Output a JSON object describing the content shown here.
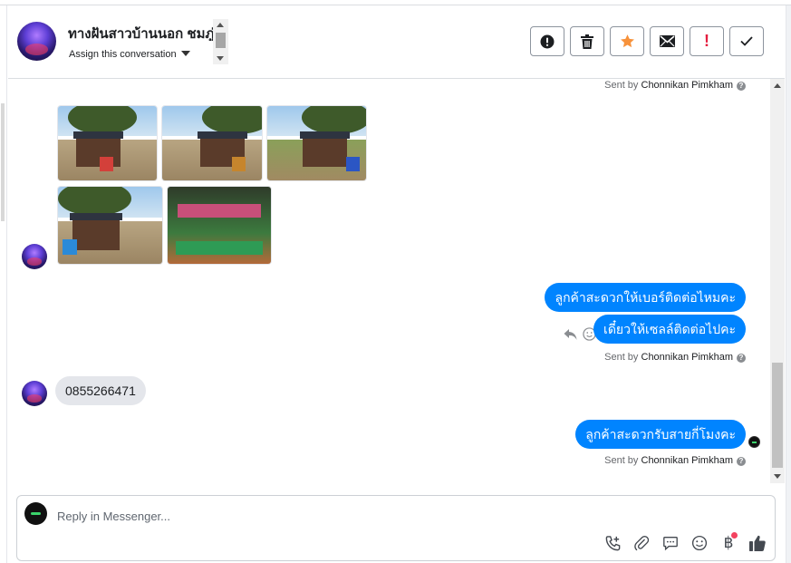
{
  "header": {
    "contact_name": "ทางฝันสาวบ้านนอก ชมภู่",
    "assign_label": "Assign this conversation"
  },
  "actions": [
    {
      "name": "mark-spam",
      "icon": "alert-circle-icon"
    },
    {
      "name": "delete",
      "icon": "trash-icon"
    },
    {
      "name": "star",
      "icon": "star-icon",
      "color": "#f7923b"
    },
    {
      "name": "mark-unread",
      "icon": "envelope-icon"
    },
    {
      "name": "follow-up",
      "icon": "exclamation-icon",
      "label": "!",
      "color": "#e41e3f"
    },
    {
      "name": "mark-done",
      "icon": "check-icon"
    }
  ],
  "messages": {
    "sent_by_prefix": "Sent by",
    "agent_name": "Chonnikan Pimkham",
    "outgoing_1": "ลูกค้าสะดวกให้เบอร์ติดต่อไหมคะ",
    "outgoing_2": "เดี๋ยวให้เซลล์ติดต่อไปคะ",
    "incoming_phone": "0855266471",
    "outgoing_3": "ลูกค้าสะดวกรับสายกี่โมงคะ"
  },
  "composer": {
    "placeholder": "Reply in Messenger...",
    "baht_symbol": "฿"
  },
  "colors": {
    "outgoing_bubble": "#0084ff",
    "incoming_bubble": "#e4e6eb",
    "notification_dot": "#f3425f"
  }
}
